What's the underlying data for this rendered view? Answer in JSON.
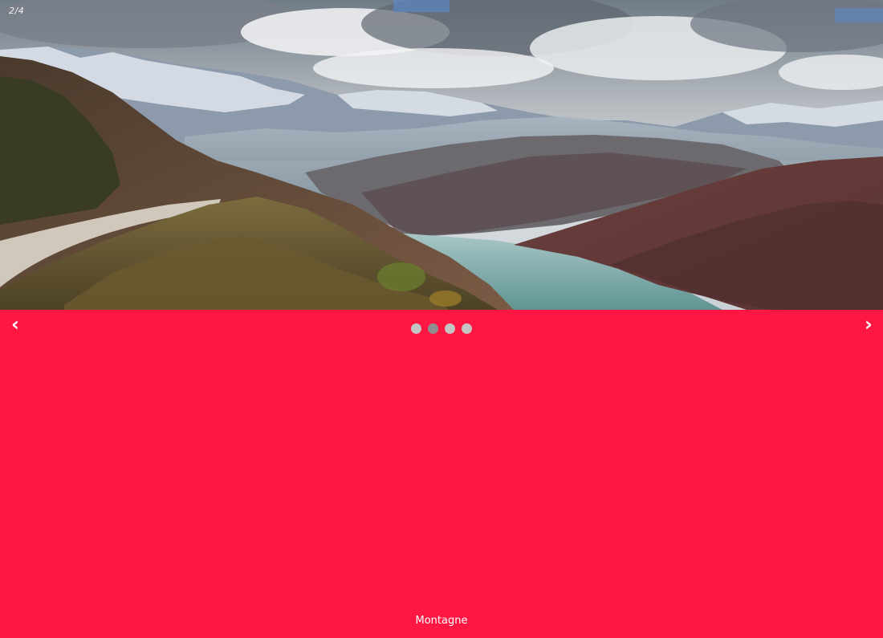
{
  "slideshow": {
    "counter": "2/4",
    "caption": "Montagne",
    "prev_label": "‹",
    "next_label": "›",
    "total_slides": 4,
    "active_slide": 2,
    "background_color": "#ff1744",
    "dot_color": "#c4c4c4",
    "active_dot_color": "#8f8f8f",
    "image_subject": "mountain landscape with road and lake"
  }
}
